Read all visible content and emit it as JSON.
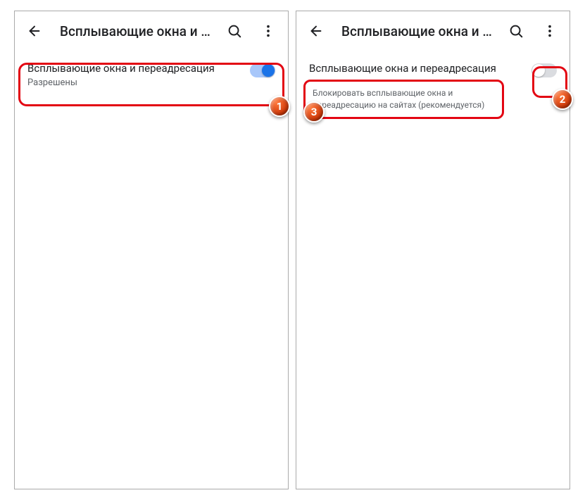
{
  "markers": {
    "one": "1",
    "two": "2",
    "three": "3"
  },
  "left": {
    "title": "Всплывающие окна и п…",
    "setting_title": "Всплывающие окна и переадресация",
    "setting_sub": "Разрешены"
  },
  "right": {
    "title": "Всплывающие окна и п…",
    "setting_title": "Всплывающие окна и переадресация",
    "tooltip": "Блокировать всплывающие окна и переадресацию на сайтах (рекомендуется)"
  },
  "colors": {
    "accent": "#1a73e8",
    "highlight": "#e30613"
  }
}
